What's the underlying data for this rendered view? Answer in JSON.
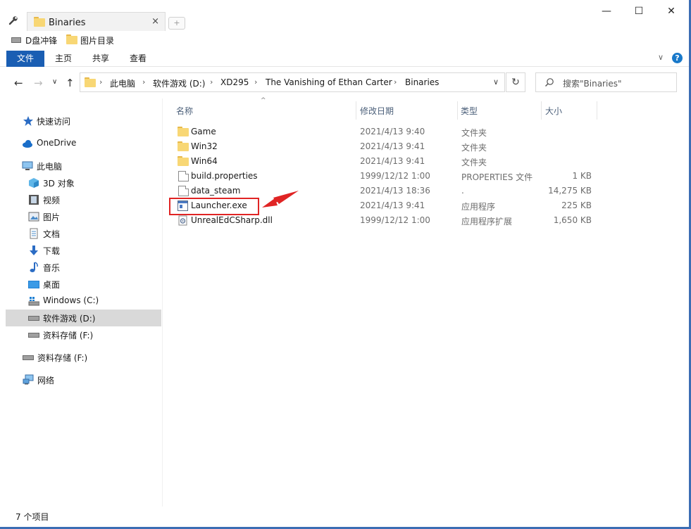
{
  "window": {
    "tab_title": "Binaries",
    "tab_close": "×",
    "new_tab": "+",
    "minimize": "—",
    "maximize": "☐",
    "close": "✕"
  },
  "favorites": [
    {
      "label": "D盘冲锋",
      "icon": "drive-icon"
    },
    {
      "label": "图片目录",
      "icon": "folder-icon"
    }
  ],
  "ribbon": {
    "tabs": [
      {
        "label": "文件",
        "active": true
      },
      {
        "label": "主页",
        "active": false
      },
      {
        "label": "共享",
        "active": false
      },
      {
        "label": "查看",
        "active": false
      }
    ],
    "expand": "∨",
    "help": "?"
  },
  "nav": {
    "back": "←",
    "forward": "→",
    "recent": "∨",
    "up": "↑",
    "refresh": "↻"
  },
  "address": {
    "crumbs": [
      "此电脑",
      "软件游戏 (D:)",
      "XD295",
      "The Vanishing of Ethan Carter",
      "Binaries"
    ],
    "separator": "›",
    "dropdown": "∨"
  },
  "search": {
    "placeholder": "搜索\"Binaries\"",
    "icon": "search-icon"
  },
  "navpane": {
    "items": [
      {
        "label": "快速访问",
        "icon": "star-icon",
        "selected": false
      },
      {
        "label": "OneDrive",
        "icon": "cloud-icon",
        "selected": false
      },
      {
        "label": "此电脑",
        "icon": "computer-icon",
        "selected": false
      },
      {
        "label": "3D 对象",
        "icon": "cube-icon",
        "selected": false
      },
      {
        "label": "视频",
        "icon": "video-icon",
        "selected": false
      },
      {
        "label": "图片",
        "icon": "picture-icon",
        "selected": false
      },
      {
        "label": "文档",
        "icon": "document-icon",
        "selected": false
      },
      {
        "label": "下载",
        "icon": "download-icon",
        "selected": false
      },
      {
        "label": "音乐",
        "icon": "music-icon",
        "selected": false
      },
      {
        "label": "桌面",
        "icon": "desktop-icon",
        "selected": false
      },
      {
        "label": "Windows (C:)",
        "icon": "windows-drive-icon",
        "selected": false
      },
      {
        "label": "软件游戏 (D:)",
        "icon": "drive-icon",
        "selected": true
      },
      {
        "label": "资料存储 (F:)",
        "icon": "drive-icon",
        "selected": false
      },
      {
        "label": "资料存储 (F:)",
        "icon": "drive-icon",
        "selected": false
      },
      {
        "label": "网络",
        "icon": "network-icon",
        "selected": false
      }
    ]
  },
  "filelist": {
    "columns": [
      "名称",
      "修改日期",
      "类型",
      "大小"
    ],
    "sort_indicator": "^",
    "rows": [
      {
        "name": "Game",
        "date": "2021/4/13 9:40",
        "type": "文件夹",
        "size": "",
        "icon": "folder-icon"
      },
      {
        "name": "Win32",
        "date": "2021/4/13 9:41",
        "type": "文件夹",
        "size": "",
        "icon": "folder-icon"
      },
      {
        "name": "Win64",
        "date": "2021/4/13 9:41",
        "type": "文件夹",
        "size": "",
        "icon": "folder-icon"
      },
      {
        "name": "build.properties",
        "date": "1999/12/12 1:00",
        "type": "PROPERTIES 文件",
        "size": "1 KB",
        "icon": "file-icon"
      },
      {
        "name": "data_steam",
        "date": "2021/4/13 18:36",
        "type": ".",
        "size": "14,275 KB",
        "icon": "file-icon"
      },
      {
        "name": "Launcher.exe",
        "date": "2021/4/13 9:41",
        "type": "应用程序",
        "size": "225 KB",
        "icon": "exe-icon"
      },
      {
        "name": "UnrealEdCSharp.dll",
        "date": "1999/12/12 1:00",
        "type": "应用程序扩展",
        "size": "1,650 KB",
        "icon": "dll-icon"
      }
    ]
  },
  "status": {
    "count": "7 个项目"
  },
  "colors": {
    "accent": "#1a5eb3",
    "highlight": "#e02424",
    "frame": "#3b6db4"
  }
}
